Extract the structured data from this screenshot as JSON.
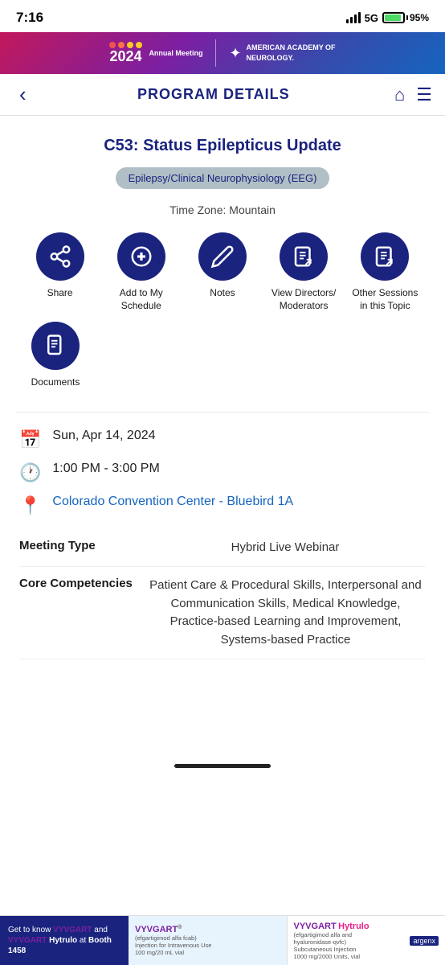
{
  "statusBar": {
    "time": "7:16",
    "signal": "strong",
    "network": "5G",
    "battery": 95
  },
  "banner": {
    "year": "2024",
    "event": "Annual Meeting",
    "orgName": "AMERICAN ACADEMY OF",
    "orgName2": "NEUROLOGY."
  },
  "nav": {
    "title": "PROGRAM DETAILS",
    "backArrow": "‹",
    "homeIcon": "⌂",
    "menuIcon": "☰"
  },
  "session": {
    "title": "C53: Status Epilepticus Update",
    "category": "Epilepsy/Clinical Neurophysiology (EEG)",
    "timezone": "Time Zone: Mountain"
  },
  "actions": [
    {
      "id": "share",
      "label": "Share",
      "icon": "share"
    },
    {
      "id": "add-schedule",
      "label": "Add to My Schedule",
      "icon": "plus"
    },
    {
      "id": "notes",
      "label": "Notes",
      "icon": "pencil"
    },
    {
      "id": "view-directors",
      "label": "View Directors/ Moderators",
      "icon": "doc-arrow"
    },
    {
      "id": "other-sessions",
      "label": "Other Sessions in this Topic",
      "icon": "doc-arrow"
    }
  ],
  "documents": {
    "label": "Documents",
    "icon": "doc-lines"
  },
  "details": {
    "date": "Sun, Apr 14, 2024",
    "time": "1:00 PM - 3:00 PM",
    "location": "Colorado Convention Center - Bluebird 1A"
  },
  "infoRows": [
    {
      "label": "Meeting Type",
      "value": "Hybrid Live Webinar"
    },
    {
      "label": "Core Competencies",
      "value": "Patient Care & Procedural Skills, Interpersonal and Communication Skills, Medical Knowledge, Practice-based Learning and Improvement, Systems-based Practice"
    }
  ],
  "adBanner": {
    "leftText": "Get to know VYVGART and VYVGART Hytrulo at Booth 1458",
    "midBrand": "VYVGART",
    "midSubtitle": "(efgartigimod alfa fcab)",
    "midDesc": "Injection for Intravenous Use\n100 mg/20 mL vial",
    "rightBrand": "VYVGART Hytrulo",
    "rightSubtitle": "(efgartigimod alfa and hyaluronidase-qvfc)",
    "rightDesc": "Subcutaneous Injection\n1000 mg/2000 Units, vial",
    "orgLabel": "argenx"
  }
}
